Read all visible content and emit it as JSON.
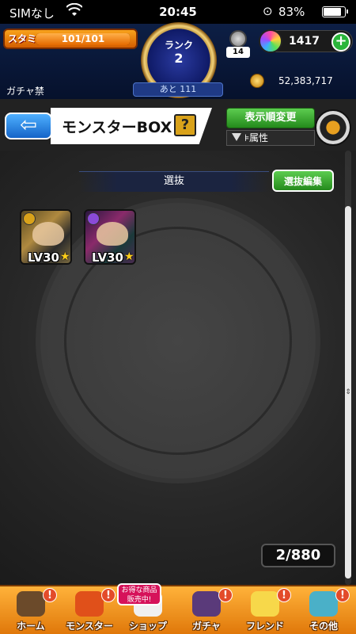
{
  "status_bar": {
    "carrier": "SIMなし",
    "time": "20:45",
    "battery_percent_text": "83%",
    "battery_level": 0.83
  },
  "header": {
    "stamina_label": "スタミナ",
    "stamina_text": "101/101",
    "stamina_fill": 1.0,
    "rank_label": "ランク",
    "rank_value": "2",
    "exp_remaining": "あと 111",
    "gacha_ban": "ガチャ禁",
    "item_level": "14",
    "orb_count": "1417",
    "orb_add_label": "+",
    "coin_count": "52,383,717"
  },
  "titlebar": {
    "back_label": "⇦",
    "title": "モンスターBOX",
    "help_label": "?",
    "sort_label": "表示順変更",
    "filter_mark": "⊧",
    "filter_label": "属性"
  },
  "main": {
    "section_label": "選抜",
    "edit_label": "選抜編集",
    "cards": [
      {
        "level": "LV30",
        "star": "★",
        "attribute": "light"
      },
      {
        "level": "LV30",
        "star": "★",
        "attribute": "dark"
      }
    ],
    "box_count": "2/880"
  },
  "nav": {
    "sale_badge": "お得な商品販売中!",
    "items": [
      {
        "label": "ホーム",
        "alert": "!",
        "color": "#6b4a2a"
      },
      {
        "label": "モンスター",
        "alert": "!",
        "color": "#e0501a"
      },
      {
        "label": "ショップ",
        "alert": "",
        "color": "#f0f0f0"
      },
      {
        "label": "ガチャ",
        "alert": "!",
        "color": "#5a3a7a"
      },
      {
        "label": "フレンド",
        "alert": "!",
        "color": "#f7d84a"
      },
      {
        "label": "その他",
        "alert": "!",
        "color": "#4ab0c8"
      }
    ]
  }
}
